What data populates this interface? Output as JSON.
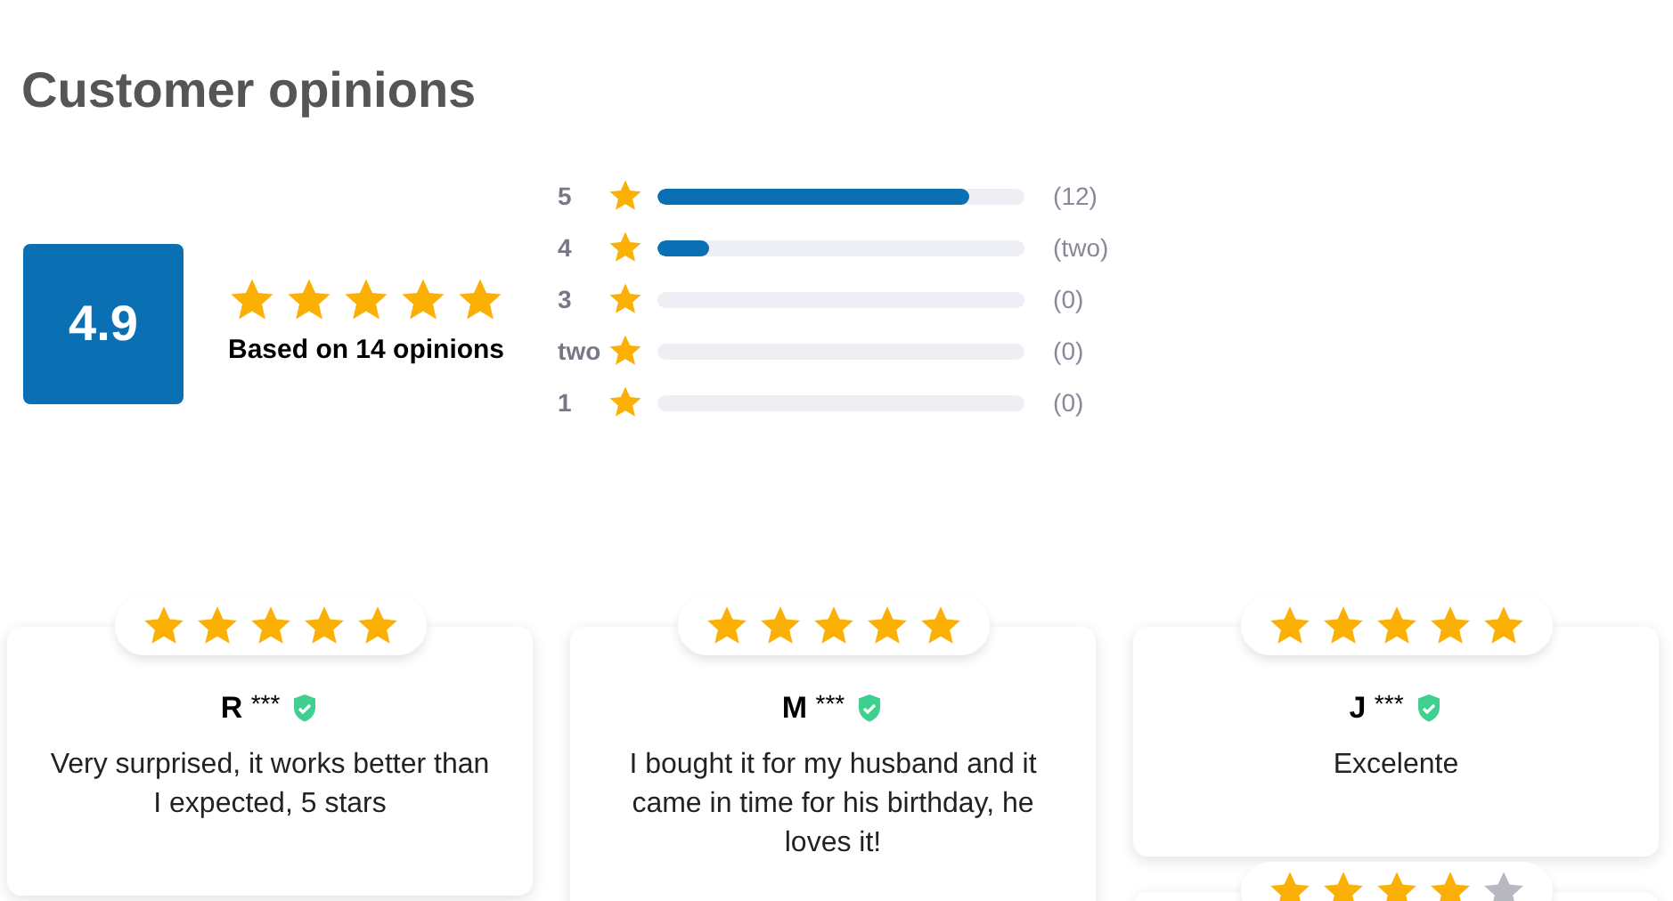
{
  "title": "Customer opinions",
  "summary": {
    "score": "4.9",
    "stars": 5,
    "based_on": "Based on 14 opinions"
  },
  "breakdown": [
    {
      "label": "5",
      "level": 0.85,
      "count": "(12)"
    },
    {
      "label": "4",
      "level": 0.14,
      "count": "(two)"
    },
    {
      "label": "3",
      "count": "(0)"
    },
    {
      "label": "two",
      "count": "(0)"
    },
    {
      "label": "1",
      "count": "(0)"
    }
  ],
  "reviews": [
    {
      "initial": "R",
      "mask": "***",
      "verified": true,
      "stars": 5,
      "text": "Very surprised, it works better than I expected, 5 stars"
    },
    {
      "initial": "M",
      "mask": "***",
      "verified": true,
      "stars": 5,
      "text": "I bought it for my husband and it came in time for his birthday, he loves it!"
    },
    {
      "initial": "J",
      "mask": "***",
      "verified": true,
      "stars": 5,
      "text": "Excelente"
    },
    {
      "stars": 4
    }
  ]
}
